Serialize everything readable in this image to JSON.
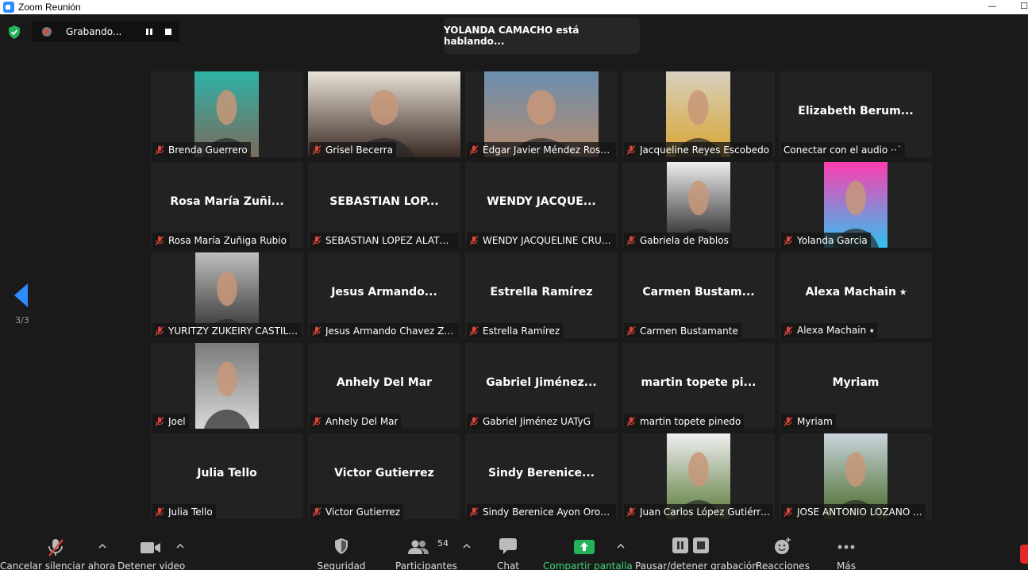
{
  "window": {
    "title": "Zoom Reunión"
  },
  "recording": {
    "label": "Grabando..."
  },
  "speaker_banner": "YOLANDA CAMACHO está hablando...",
  "pager": {
    "label": "3/3"
  },
  "colors": {
    "tile_bg": "#222222",
    "app_bg": "#1a1a1a",
    "mute_red": "#e0453a",
    "share_green": "#22b35a",
    "end_red": "#e02828"
  },
  "participants": [
    {
      "tile_name": "",
      "label": "Brenda Guerrero",
      "photo": true
    },
    {
      "tile_name": "",
      "label": "Grisel Becerra",
      "photo": true
    },
    {
      "tile_name": "",
      "label": "Édgar Javier Méndez Rosa...",
      "photo": true
    },
    {
      "tile_name": "",
      "label": "Jacqueline Reyes Escobedo",
      "photo": true
    },
    {
      "tile_name": "Elizabeth Berum...",
      "label": "Conectar con el audio ··˙",
      "photo": false
    },
    {
      "tile_name": "Rosa María Zuñi...",
      "label": "Rosa María Zuñiga Rubio",
      "photo": false
    },
    {
      "tile_name": "SEBASTIAN LOP...",
      "label": "SEBASTIAN LOPEZ ALATOR...",
      "photo": false
    },
    {
      "tile_name": "WENDY JACQUE...",
      "label": "WENDY JACQUELINE CRUZ...",
      "photo": false
    },
    {
      "tile_name": "",
      "label": "Gabriela de Pablos",
      "photo": true
    },
    {
      "tile_name": "",
      "label": "Yolanda Garcia",
      "photo": true
    },
    {
      "tile_name": "",
      "label": "YURITZY ZUKEIRY CASTILL...",
      "photo": true
    },
    {
      "tile_name": "Jesus Armando...",
      "label": "Jesus Armando Chavez Za...",
      "photo": false
    },
    {
      "tile_name": "Estrella Ramírez",
      "label": "Estrella Ramírez",
      "photo": false
    },
    {
      "tile_name": "Carmen Bustam...",
      "label": "Carmen Bustamante",
      "photo": false
    },
    {
      "tile_name": "Alexa Machain ⭑",
      "label": "Alexa Machain ⭑",
      "photo": false
    },
    {
      "tile_name": "",
      "label": "Joel",
      "photo": true
    },
    {
      "tile_name": "Anhely Del Mar",
      "label": "Anhely Del Mar",
      "photo": false
    },
    {
      "tile_name": "Gabriel Jiménez...",
      "label": "Gabriel Jiménez UATyG",
      "photo": false
    },
    {
      "tile_name": "martin topete pi...",
      "label": "martin topete pinedo",
      "photo": false
    },
    {
      "tile_name": "Myriam",
      "label": "Myriam",
      "photo": false
    },
    {
      "tile_name": "Julia Tello",
      "label": "Julia Tello",
      "photo": false
    },
    {
      "tile_name": "Victor Gutierrez",
      "label": "Victor Gutierrez",
      "photo": false
    },
    {
      "tile_name": "Sindy Berenice...",
      "label": "Sindy Berenice Ayon Orozco",
      "photo": false
    },
    {
      "tile_name": "",
      "label": "Juan Carlos López Gutiérrez",
      "photo": true
    },
    {
      "tile_name": "",
      "label": "JOSE ANTONIO LOZANO ...",
      "photo": true
    }
  ],
  "toolbar": {
    "unmute": "Cancelar silenciar ahora",
    "video": "Detener video",
    "security": "Seguridad",
    "participants": "Participantes",
    "participants_count": "54",
    "chat": "Chat",
    "share": "Compartir pantalla",
    "pause_recording": "Pausar/detener grabación",
    "reactions": "Reacciones",
    "more": "Más"
  }
}
